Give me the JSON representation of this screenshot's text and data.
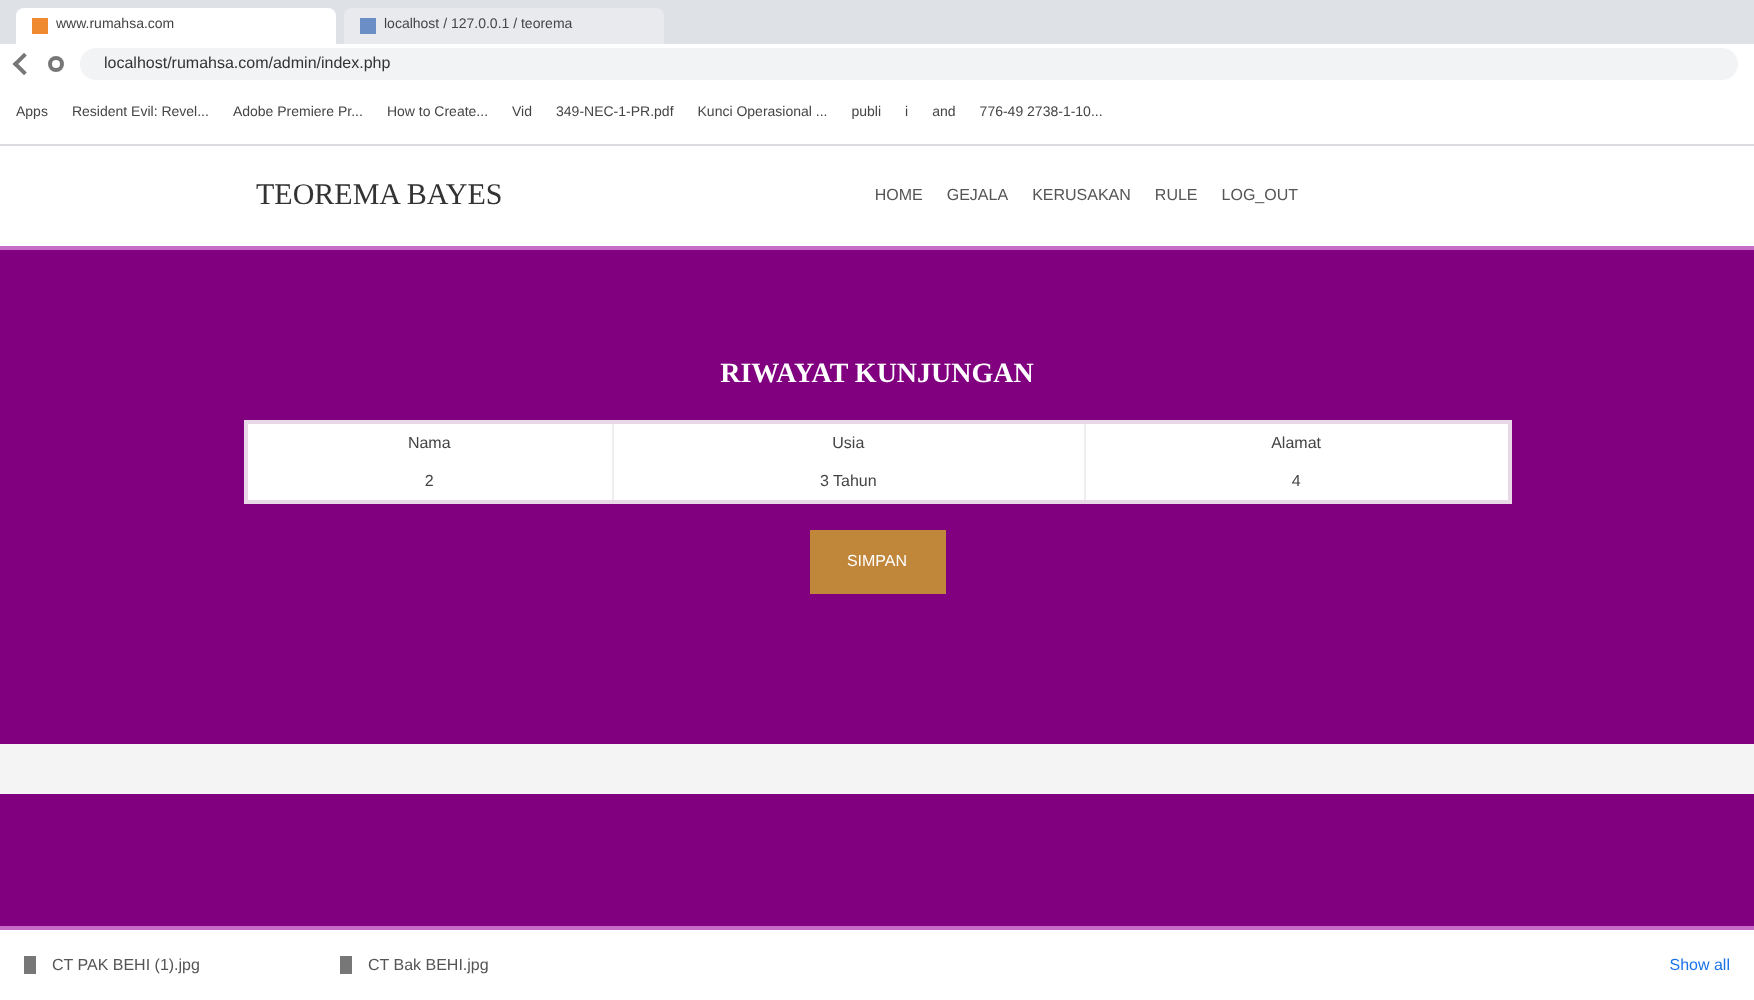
{
  "browser": {
    "tabs": [
      {
        "title": "www.rumahsa.com",
        "selected": true
      },
      {
        "title": "localhost / 127.0.0.1 / teorema",
        "selected": false
      }
    ],
    "url": "localhost/rumahsa.com/admin/index.php",
    "bookmarks": [
      "Apps",
      "Resident Evil: Revel...",
      "Adobe Premiere Pr...",
      "How to Create...",
      "Vid",
      "349-NEC-1-PR.pdf",
      "Kunci Operasional ...",
      "publi",
      "i",
      "and",
      "776-49 2738-1-10..."
    ]
  },
  "navbar": {
    "brand": "TEOREMA BAYES",
    "links": [
      "HOME",
      "GEJALA",
      "KERUSAKAN",
      "RULE",
      "LOG_OUT"
    ]
  },
  "section": {
    "title": "RIWAYAT KUNJUNGAN",
    "table": {
      "columns": [
        "Nama",
        "Usia",
        "Alamat"
      ],
      "rows": [
        [
          "2",
          "3 Tahun",
          "4"
        ]
      ]
    },
    "button": "SIMPAN"
  },
  "downloads": {
    "files": [
      "CT PAK BEHI (1).jpg",
      "CT Bak BEHI.jpg"
    ],
    "show_all": "Show all"
  }
}
